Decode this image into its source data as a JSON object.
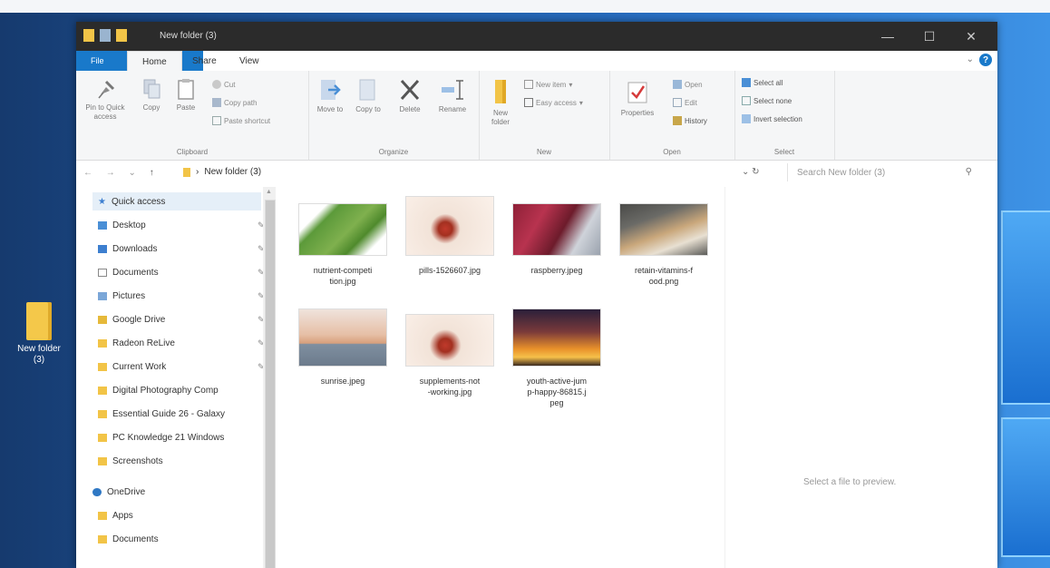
{
  "desktop": {
    "icon_label": "New folder (3)"
  },
  "window": {
    "title": "New folder (3)",
    "controls": {
      "minimize": "—",
      "maximize": "☐",
      "close": "✕"
    }
  },
  "menu": {
    "file": "File",
    "home": "Home",
    "share": "Share",
    "view": "View"
  },
  "ribbon": {
    "clipboard": {
      "label": "Clipboard",
      "pin_to_quick_access": "Pin to Quick access",
      "copy": "Copy",
      "paste": "Paste",
      "cut": "Cut",
      "copy_path": "Copy path",
      "paste_shortcut": "Paste shortcut"
    },
    "organize": {
      "label": "Organize",
      "move_to": "Move to",
      "copy_to": "Copy to",
      "delete": "Delete",
      "rename": "Rename"
    },
    "new": {
      "label": "New",
      "new_folder": "New folder",
      "new_item": "New item",
      "easy_access": "Easy access"
    },
    "open": {
      "label": "Open",
      "properties": "Properties",
      "open": "Open",
      "edit": "Edit",
      "history": "History"
    },
    "select": {
      "label": "Select",
      "select_all": "Select all",
      "select_none": "Select none",
      "invert_selection": "Invert selection"
    }
  },
  "address": {
    "breadcrumb": "New folder (3)",
    "search_placeholder": "Search New folder (3)"
  },
  "nav": {
    "items": [
      {
        "label": "Quick access"
      },
      {
        "label": "Desktop"
      },
      {
        "label": "Downloads"
      },
      {
        "label": "Documents"
      },
      {
        "label": "Pictures"
      },
      {
        "label": "Google Drive"
      },
      {
        "label": "Radeon ReLive"
      },
      {
        "label": "Current Work"
      },
      {
        "label": "Digital Photography Comp"
      },
      {
        "label": "Essential Guide 26 - Galaxy"
      },
      {
        "label": "PC Knowledge 21 Windows"
      },
      {
        "label": "Screenshots"
      },
      {
        "label": "OneDrive"
      },
      {
        "label": "Apps"
      },
      {
        "label": "Documents"
      }
    ]
  },
  "files": [
    {
      "name": "nutrient-competition.jpg",
      "line1": "nutrient-competi",
      "line2": "tion.jpg",
      "line3": ""
    },
    {
      "name": "pills-1526607.jpg",
      "line1": "pills-1526607.jpg",
      "line2": "",
      "line3": ""
    },
    {
      "name": "raspberry.jpeg",
      "line1": "raspberry.jpeg",
      "line2": "",
      "line3": ""
    },
    {
      "name": "retain-vitamins-food.png",
      "line1": "retain-vitamins-f",
      "line2": "ood.png",
      "line3": ""
    },
    {
      "name": "sunrise.jpeg",
      "line1": "sunrise.jpeg",
      "line2": "",
      "line3": ""
    },
    {
      "name": "supplements-not-working.jpg",
      "line1": "supplements-not",
      "line2": "-working.jpg",
      "line3": ""
    },
    {
      "name": "youth-active-jump-happy-86815.jpeg",
      "line1": "youth-active-jum",
      "line2": "p-happy-86815.j",
      "line3": "peg"
    }
  ],
  "preview": {
    "message": "Select a file to preview."
  },
  "colors": {
    "accent": "#1979ca",
    "titlebar": "#2b2b2b",
    "folder": "#f2c447"
  }
}
